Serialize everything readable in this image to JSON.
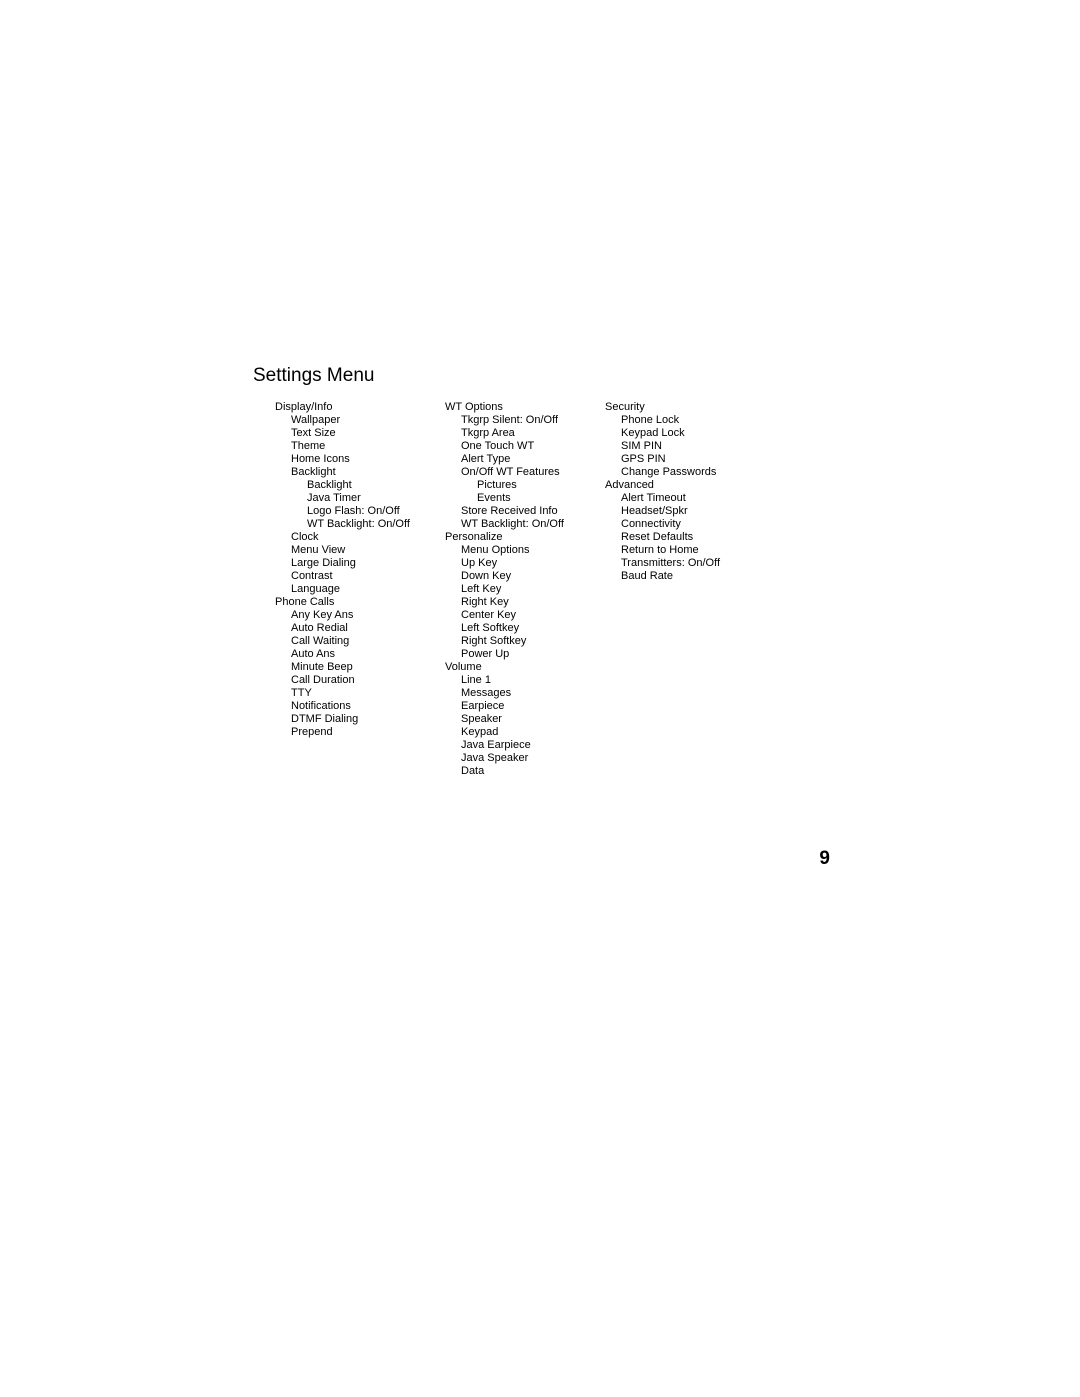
{
  "title": "Settings Menu",
  "page_number": "9",
  "columns": [
    [
      {
        "t": "Display/Info",
        "l": 0
      },
      {
        "t": "Wallpaper",
        "l": 1
      },
      {
        "t": "Text Size",
        "l": 1
      },
      {
        "t": "Theme",
        "l": 1
      },
      {
        "t": "Home Icons",
        "l": 1
      },
      {
        "t": "Backlight",
        "l": 1
      },
      {
        "t": "Backlight",
        "l": 2
      },
      {
        "t": "Java Timer",
        "l": 2
      },
      {
        "t": "Logo Flash: On/Off",
        "l": 2
      },
      {
        "t": "WT Backlight: On/Off",
        "l": 2
      },
      {
        "t": "Clock",
        "l": 1
      },
      {
        "t": "Menu View",
        "l": 1
      },
      {
        "t": "Large Dialing",
        "l": 1
      },
      {
        "t": "Contrast",
        "l": 1
      },
      {
        "t": "Language",
        "l": 1
      },
      {
        "t": "Phone Calls",
        "l": 0
      },
      {
        "t": "Any Key Ans",
        "l": 1
      },
      {
        "t": "Auto Redial",
        "l": 1
      },
      {
        "t": "Call Waiting",
        "l": 1
      },
      {
        "t": "Auto Ans",
        "l": 1
      },
      {
        "t": "Minute Beep",
        "l": 1
      },
      {
        "t": "Call Duration",
        "l": 1
      },
      {
        "t": "TTY",
        "l": 1
      },
      {
        "t": "Notifications",
        "l": 1
      },
      {
        "t": "DTMF Dialing",
        "l": 1
      },
      {
        "t": "Prepend",
        "l": 1
      }
    ],
    [
      {
        "t": "WT Options",
        "l": 0
      },
      {
        "t": "Tkgrp Silent: On/Off",
        "l": 1
      },
      {
        "t": "Tkgrp Area",
        "l": 1
      },
      {
        "t": "One Touch WT",
        "l": 1
      },
      {
        "t": "Alert Type",
        "l": 1
      },
      {
        "t": "On/Off WT Features",
        "l": 1
      },
      {
        "t": "Pictures",
        "l": 2
      },
      {
        "t": "Events",
        "l": 2
      },
      {
        "t": "Store Received Info",
        "l": 1
      },
      {
        "t": "WT Backlight: On/Off",
        "l": 1
      },
      {
        "t": "Personalize",
        "l": 0
      },
      {
        "t": "Menu Options",
        "l": 1
      },
      {
        "t": "Up Key",
        "l": 1
      },
      {
        "t": "Down Key",
        "l": 1
      },
      {
        "t": "Left Key",
        "l": 1
      },
      {
        "t": "Right Key",
        "l": 1
      },
      {
        "t": "Center Key",
        "l": 1
      },
      {
        "t": "Left Softkey",
        "l": 1
      },
      {
        "t": "Right Softkey",
        "l": 1
      },
      {
        "t": "Power Up",
        "l": 1
      },
      {
        "t": "Volume",
        "l": 0
      },
      {
        "t": "Line 1",
        "l": 1
      },
      {
        "t": "Messages",
        "l": 1
      },
      {
        "t": "Earpiece",
        "l": 1
      },
      {
        "t": "Speaker",
        "l": 1
      },
      {
        "t": "Keypad",
        "l": 1
      },
      {
        "t": "Java Earpiece",
        "l": 1
      },
      {
        "t": "Java Speaker",
        "l": 1
      },
      {
        "t": "Data",
        "l": 1
      }
    ],
    [
      {
        "t": "Security",
        "l": 0
      },
      {
        "t": "Phone Lock",
        "l": 1
      },
      {
        "t": "Keypad Lock",
        "l": 1
      },
      {
        "t": "SIM PIN",
        "l": 1
      },
      {
        "t": "GPS PIN",
        "l": 1
      },
      {
        "t": "Change Passwords",
        "l": 1
      },
      {
        "t": "Advanced",
        "l": 0
      },
      {
        "t": "Alert Timeout",
        "l": 1
      },
      {
        "t": "Headset/Spkr",
        "l": 1
      },
      {
        "t": "Connectivity",
        "l": 1
      },
      {
        "t": "Reset Defaults",
        "l": 1
      },
      {
        "t": "Return to Home",
        "l": 1
      },
      {
        "t": "Transmitters: On/Off",
        "l": 1
      },
      {
        "t": "Baud Rate",
        "l": 1
      }
    ]
  ]
}
